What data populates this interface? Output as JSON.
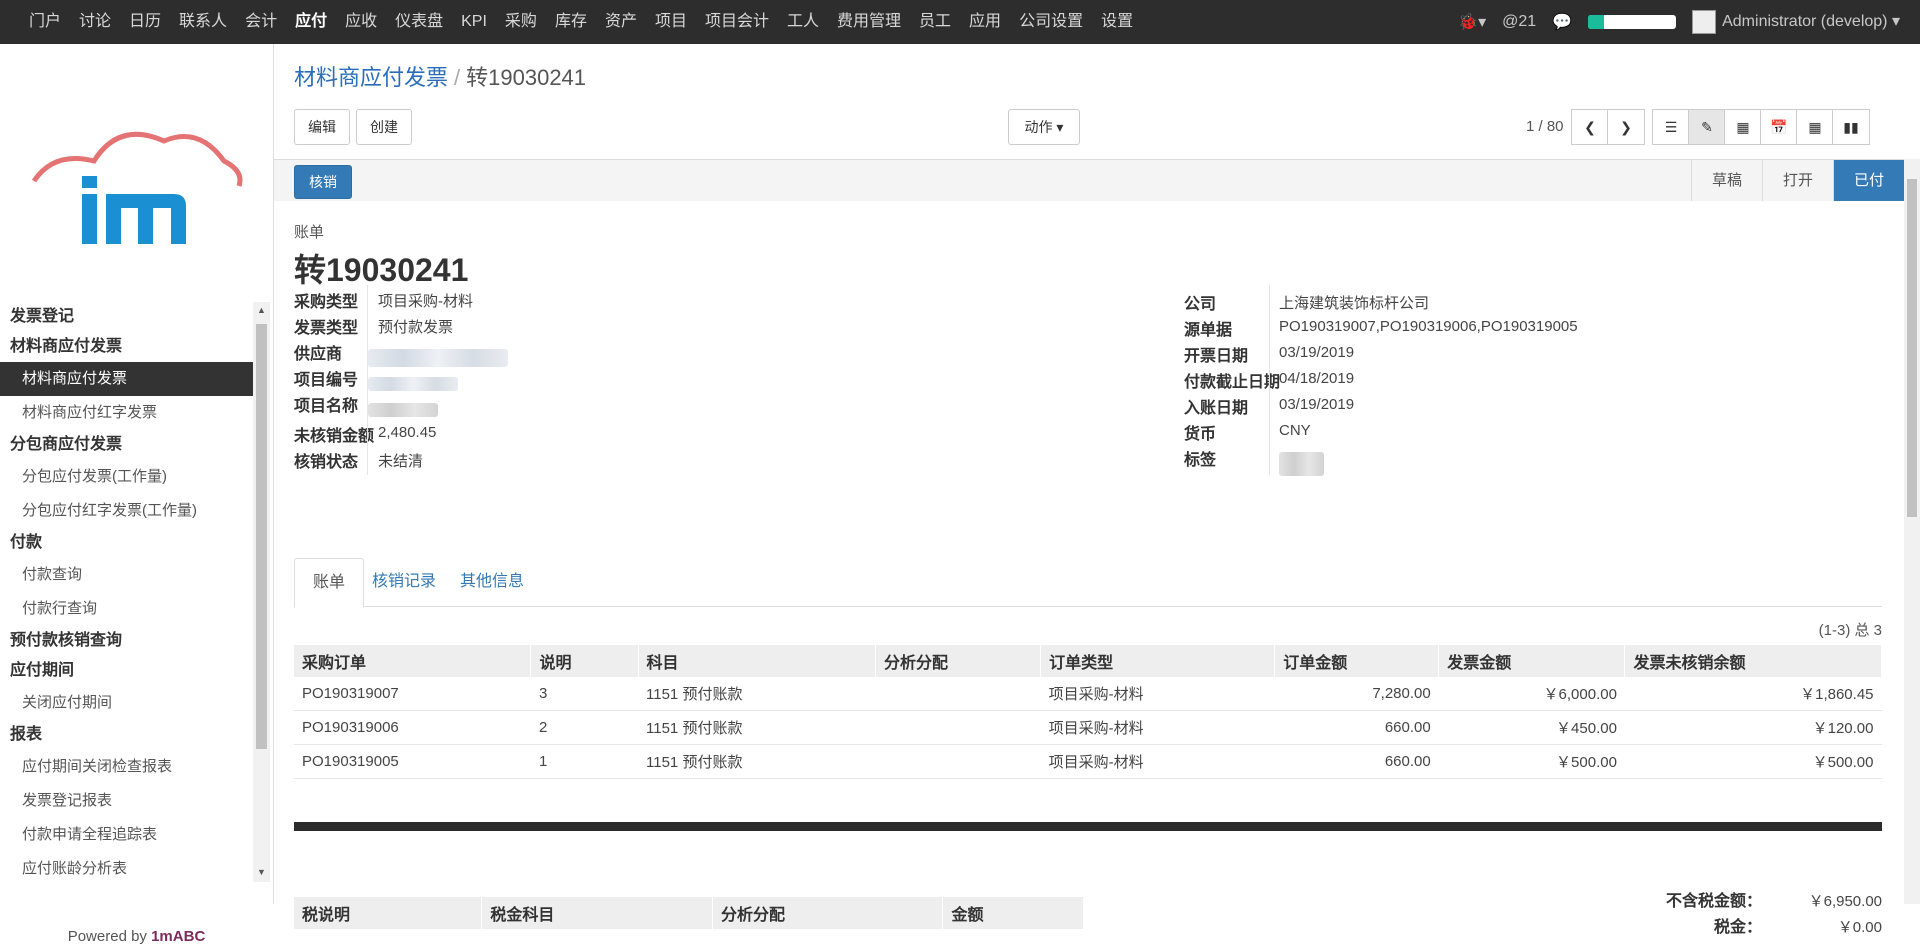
{
  "topnav": {
    "items": [
      "门户",
      "讨论",
      "日历",
      "联系人",
      "会计",
      "应付",
      "应收",
      "仪表盘",
      "KPI",
      "采购",
      "库存",
      "资产",
      "项目",
      "项目会计",
      "工人",
      "费用管理",
      "员工",
      "应用",
      "公司设置",
      "设置"
    ],
    "active_index": 5,
    "mentions_count": "@21",
    "progress_fraction": 0.18,
    "user": "Administrator (develop)",
    "accent_color": "#1abc9c"
  },
  "sidebar": {
    "sections": [
      {
        "title": "发票登记",
        "items": []
      },
      {
        "title": "材料商应付发票",
        "items": [
          "材料商应付发票",
          "材料商应付红字发票"
        ]
      },
      {
        "title": "分包商应付发票",
        "items": [
          "分包应付发票(工作量)",
          "分包应付红字发票(工作量)"
        ]
      },
      {
        "title": "付款",
        "items": [
          "付款查询",
          "付款行查询"
        ]
      },
      {
        "title": "预付款核销查询",
        "items": []
      },
      {
        "title": "应付期间",
        "items": [
          "关闭应付期间"
        ]
      },
      {
        "title": "报表",
        "items": [
          "应付期间关闭检查报表",
          "发票登记报表",
          "付款申请全程追踪表",
          "应付账龄分析表"
        ]
      }
    ],
    "active_item": "材料商应付发票",
    "powered_prefix": "Powered by",
    "powered_brand": "1mABC"
  },
  "breadcrumb": {
    "parent": "材料商应付发票",
    "sep": "/",
    "current": "转19030241"
  },
  "toolbar": {
    "edit": "编辑",
    "create": "创建",
    "action": "动作",
    "pager": "1 / 80"
  },
  "statusbar": {
    "validate_button": "核销",
    "stages": [
      "草稿",
      "打开",
      "已付"
    ],
    "active_stage": "已付"
  },
  "document": {
    "kind": "账单",
    "name": "转19030241",
    "left_fields": [
      {
        "label": "采购类型",
        "value": "项目采购-材料"
      },
      {
        "label": "发票类型",
        "value": "预付款发票"
      },
      {
        "label": "供应商",
        "value": ""
      },
      {
        "label": "项目编号",
        "value": ""
      },
      {
        "label": "项目名称",
        "value": ""
      },
      {
        "label": "未核销金额",
        "value": "2,480.45"
      },
      {
        "label": "核销状态",
        "value": "未结清"
      }
    ],
    "right_fields": [
      {
        "label": "公司",
        "value": "上海建筑装饰标杆公司"
      },
      {
        "label": "源单据",
        "value": "PO190319007,PO190319006,PO190319005"
      },
      {
        "label": "开票日期",
        "value": "03/19/2019"
      },
      {
        "label": "付款截止日期",
        "value": "04/18/2019"
      },
      {
        "label": "入账日期",
        "value": "03/19/2019"
      },
      {
        "label": "货币",
        "value": "CNY"
      },
      {
        "label": "标签",
        "value": ""
      }
    ]
  },
  "tabs": [
    "账单",
    "核销记录",
    "其他信息"
  ],
  "lines": {
    "count": "(1-3) 总 3",
    "columns": [
      "采购订单",
      "说明",
      "科目",
      "分析分配",
      "订单类型",
      "订单金额",
      "发票金额",
      "发票未核销余额"
    ],
    "rows": [
      [
        "PO190319007",
        "3",
        "1151 预付账款",
        "",
        "项目采购-材料",
        "7,280.00",
        "￥6,000.00",
        "￥1,860.45"
      ],
      [
        "PO190319006",
        "2",
        "1151 预付账款",
        "",
        "项目采购-材料",
        "660.00",
        "￥450.00",
        "￥120.00"
      ],
      [
        "PO190319005",
        "1",
        "1151 预付账款",
        "",
        "项目采购-材料",
        "660.00",
        "￥500.00",
        "￥500.00"
      ]
    ]
  },
  "tax": {
    "columns": [
      "税说明",
      "税金科目",
      "分析分配",
      "金额"
    ]
  },
  "totals": [
    {
      "label": "不含税金额：",
      "value": "￥6,950.00"
    },
    {
      "label": "税金：",
      "value": "￥0.00"
    }
  ]
}
